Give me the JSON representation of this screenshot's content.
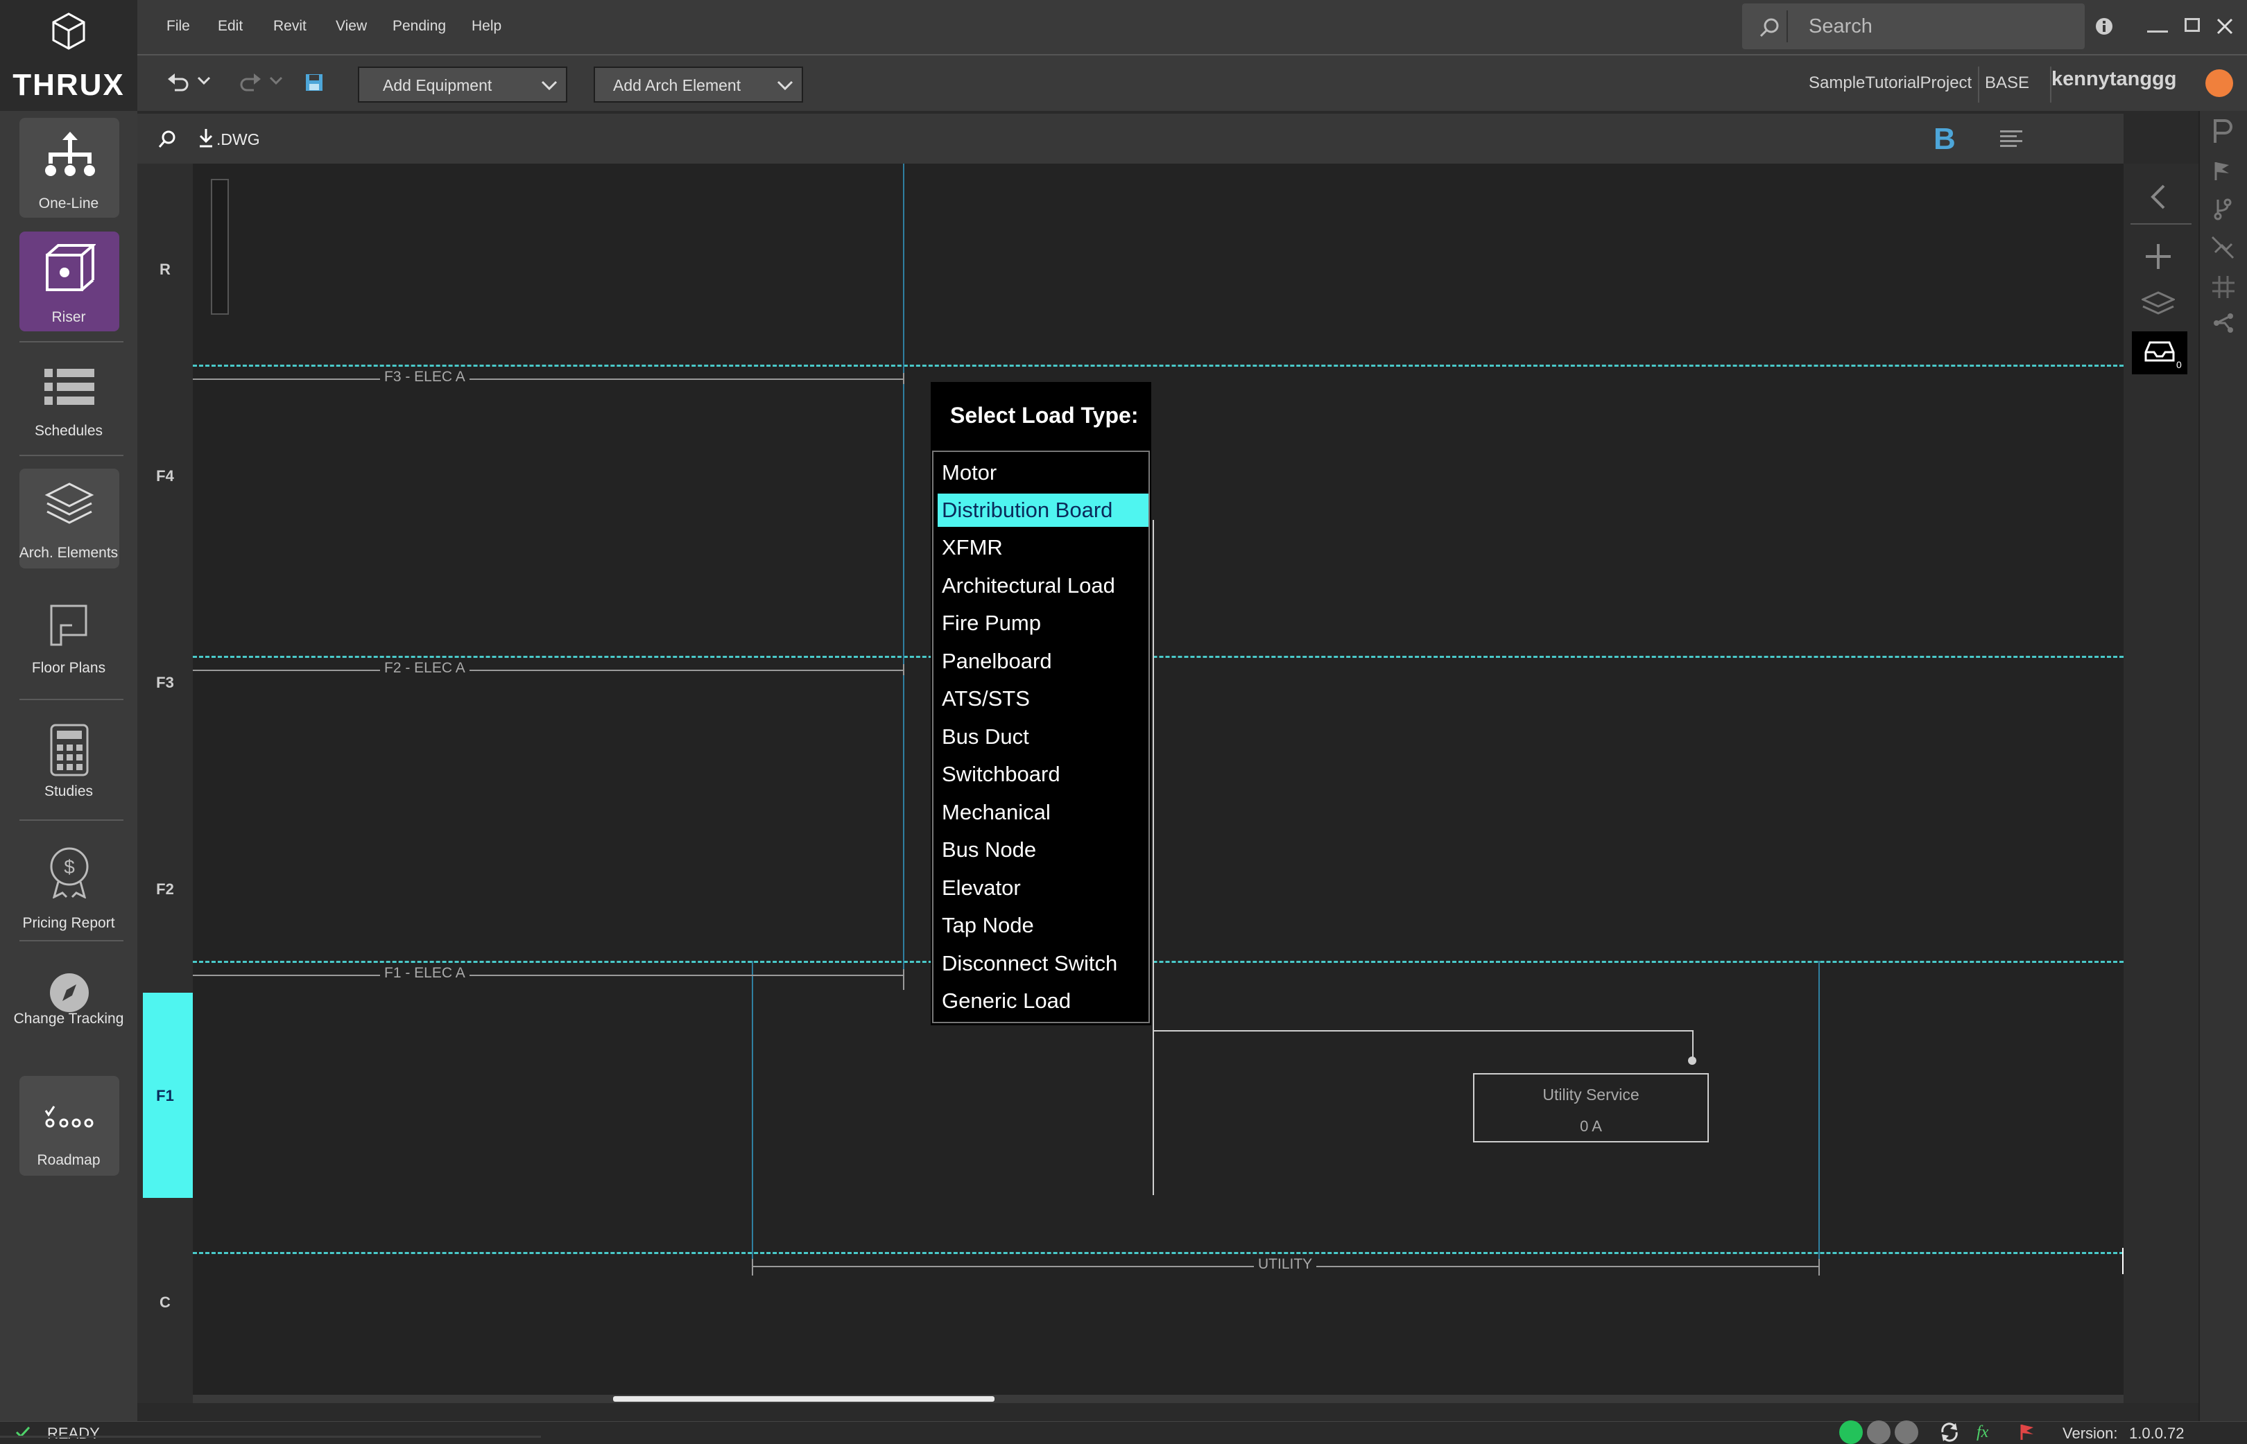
{
  "app": {
    "name": "THRUX"
  },
  "nav": [
    {
      "label": "One-Line"
    },
    {
      "label": "Riser"
    },
    {
      "label": "Schedules"
    },
    {
      "label": "Arch. Elements"
    },
    {
      "label": "Floor Plans"
    },
    {
      "label": "Studies"
    },
    {
      "label": "Pricing Report"
    },
    {
      "label": "Change Tracking"
    },
    {
      "label": "Roadmap"
    }
  ],
  "menu": [
    "File",
    "Edit",
    "Revit",
    "View",
    "Pending",
    "Help"
  ],
  "search": {
    "placeholder": "Search"
  },
  "toolbar": {
    "add_equipment": "Add Equipment",
    "add_arch": "Add Arch Element",
    "dwg": ".DWG",
    "b_icon": "B"
  },
  "project": {
    "name": "SampleTutorialProject",
    "base": "BASE",
    "user": "kennytanggg"
  },
  "floors": [
    "R",
    "F4",
    "F3",
    "F2",
    "F1",
    "C"
  ],
  "active_floor": "F1",
  "lines": {
    "f3": "F3 - ELEC A",
    "f2": "F2 - ELEC A",
    "f1": "F1 - ELEC A",
    "utility": "UTILITY"
  },
  "popup": {
    "title": "Select Load Type:",
    "options": [
      "Motor",
      "Distribution Board",
      "XFMR",
      "Architectural Load",
      "Fire Pump",
      "Panelboard",
      "ATS/STS",
      "Bus Duct",
      "Switchboard",
      "Mechanical",
      "Bus Node",
      "Elevator",
      "Tap Node",
      "Disconnect Switch",
      "Generic Load"
    ],
    "selected": "Distribution Board"
  },
  "utility_box": {
    "name": "Utility Service",
    "current": "0 A"
  },
  "inbox_count": "0",
  "status": {
    "state": "READY",
    "version_label": "Version:",
    "version": "1.0.0.72",
    "fx": "fx"
  },
  "colors": {
    "accent": "#4ff5f0",
    "riser": "#6a3d80",
    "dashed": "#49c9c9"
  },
  "icons": [
    "undo-icon",
    "redo-icon",
    "save-icon",
    "search-icon",
    "info-icon",
    "download-icon",
    "collapse-icon",
    "plus-icon",
    "layers-icon",
    "inbox-icon",
    "flag-icon",
    "branch-icon"
  ]
}
